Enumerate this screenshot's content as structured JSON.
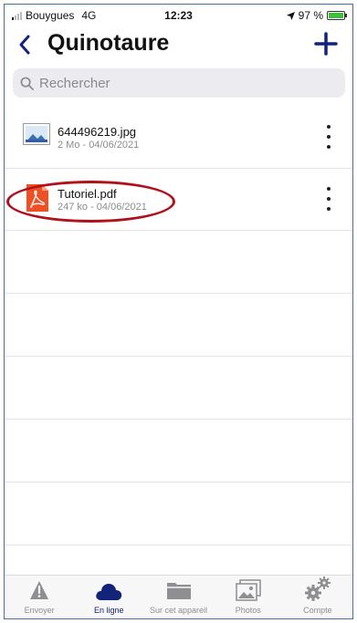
{
  "status_bar": {
    "carrier": "Bouygues",
    "network": "4G",
    "time": "12:23",
    "battery": "97 %",
    "battery_level": 0.97
  },
  "header": {
    "title": "Quinotaure",
    "back_icon": "chevron-left-icon",
    "add_icon": "plus-icon"
  },
  "search": {
    "placeholder": "Rechercher"
  },
  "files": [
    {
      "name": "644496219.jpg",
      "meta": "2 Mo - 04/06/2021",
      "icon": "image-file-icon"
    },
    {
      "name": "Tutoriel.pdf",
      "meta": "247 ko - 04/06/2021",
      "icon": "pdf-file-icon"
    }
  ],
  "tabs": [
    {
      "label": "Envoyer",
      "icon": "warning-triangle-icon",
      "active": false
    },
    {
      "label": "En ligne",
      "icon": "cloud-icon",
      "active": true
    },
    {
      "label": "Sur cet appareil",
      "icon": "folder-icon",
      "active": false
    },
    {
      "label": "Photos",
      "icon": "photos-icon",
      "active": false
    },
    {
      "label": "Compte",
      "icon": "gears-icon",
      "active": false
    }
  ],
  "colors": {
    "accent": "#13237a",
    "highlight": "#b0121b",
    "pdf": "#f04e23",
    "battery": "#3fbf3f"
  }
}
